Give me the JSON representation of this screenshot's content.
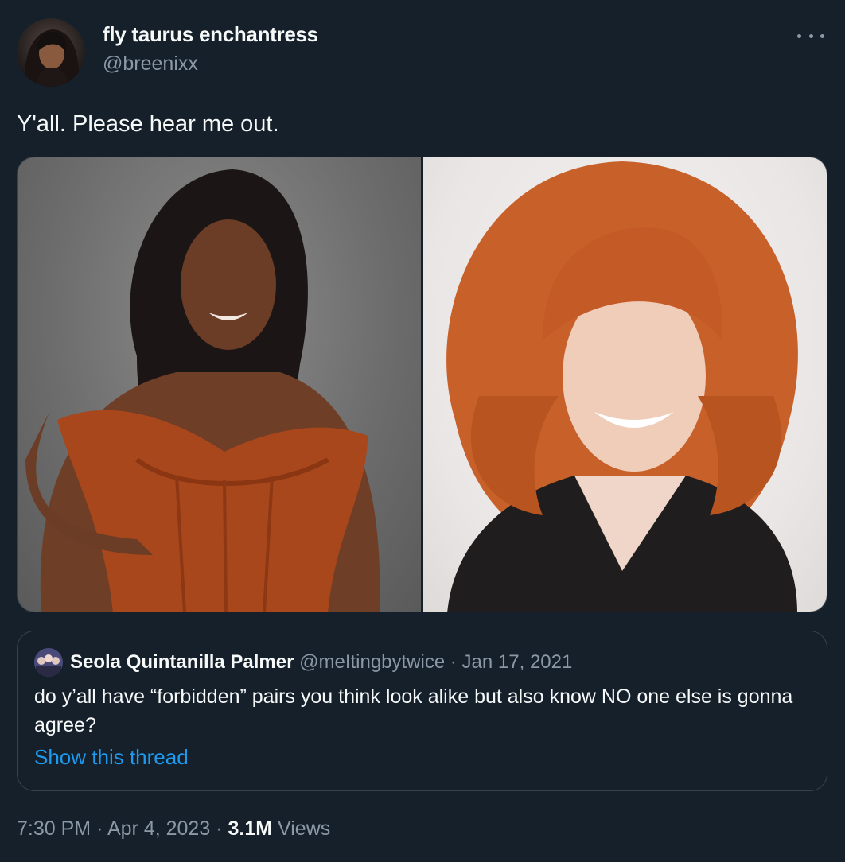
{
  "author": {
    "display_name": "fly taurus enchantress",
    "handle": "@breenixx"
  },
  "tweet": {
    "text": "Y'all. Please hear me out."
  },
  "more_icon": "more-horizontal-icon",
  "quoted_tweet": {
    "display_name": "Seola Quintanilla Palmer",
    "handle": "@meItingbytwice",
    "separator": "·",
    "date": "Jan 17, 2021",
    "text": "do y’all have “forbidden” pairs you think look alike but also know NO one else is gonna agree?",
    "link_label": "Show this thread"
  },
  "meta": {
    "time": "7:30 PM",
    "sep1": "·",
    "date": "Apr 4, 2023",
    "sep2": "·",
    "views_count": "3.1M",
    "views_label": "Views"
  },
  "colors": {
    "background": "#15202b",
    "text_primary": "#f7f9f9",
    "text_secondary": "#8b98a5",
    "link": "#1d9bf0",
    "border": "#38444d"
  }
}
